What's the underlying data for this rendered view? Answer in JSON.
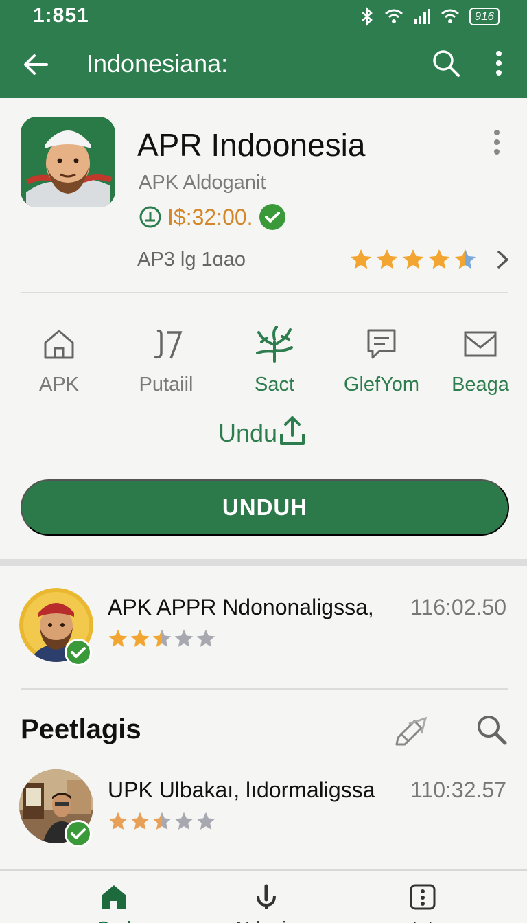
{
  "status_bar": {
    "time": "1:851",
    "battery": "916"
  },
  "app_bar": {
    "title": "Indonesiana:"
  },
  "app": {
    "name": "APR Indoonesia",
    "developer": "APK Aldoganit",
    "price": "I$:32:00.",
    "meta": "AP3 lg 1ɑao",
    "rating_stars": 4.5
  },
  "actions": [
    {
      "label": "APK",
      "icon": "home-outline-icon"
    },
    {
      "label": "Putaiil",
      "icon": "j7-icon"
    },
    {
      "label": "Sact",
      "icon": "branch-icon"
    },
    {
      "label": "GlefYom",
      "icon": "chat-icon"
    },
    {
      "label": "Beaga",
      "icon": "mail-icon"
    }
  ],
  "undu_label": "Undu",
  "download_button": "UNDUH",
  "list_items": [
    {
      "title": "APK APPR Ndononaligssa,",
      "time": "116:02.50",
      "rating_stars": 2.5
    },
    {
      "title": "UPK Ulbakaı, lıdormaligssa",
      "time": "110:32.57",
      "rating_stars": 2.5
    }
  ],
  "section": {
    "title": "Peetlagis"
  },
  "bottom_nav": [
    {
      "label": "Sod",
      "icon": "home-icon",
      "active": true
    },
    {
      "label": "Nduain",
      "icon": "mic-icon",
      "active": false
    },
    {
      "label": "Iet",
      "icon": "info-icon",
      "active": false
    }
  ],
  "colors": {
    "primary": "#2e7d4f",
    "star": "#f2a531",
    "price": "#d4872a"
  }
}
